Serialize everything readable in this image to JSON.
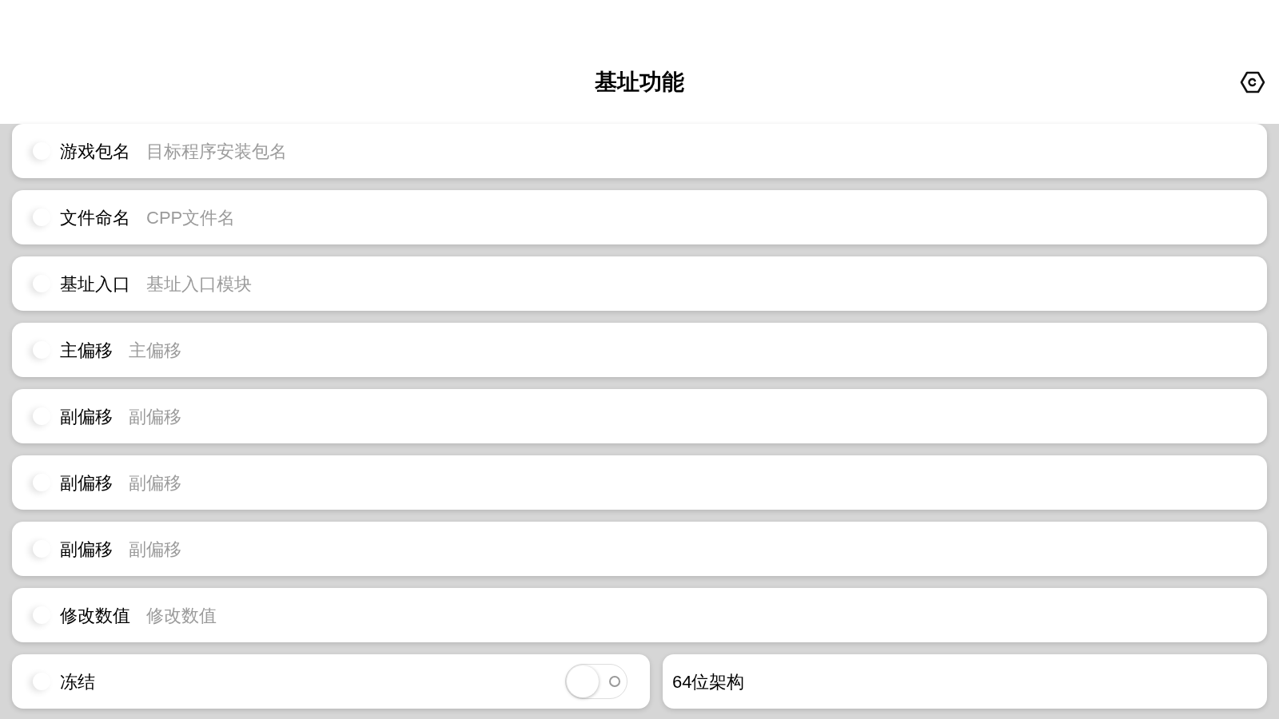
{
  "title": "基址功能",
  "fields": [
    {
      "label": "游戏包名",
      "placeholder": "目标程序安装包名"
    },
    {
      "label": "文件命名",
      "placeholder": "CPP文件名"
    },
    {
      "label": "基址入口",
      "placeholder": "基址入口模块"
    },
    {
      "label": "主偏移",
      "placeholder": "主偏移"
    },
    {
      "label": "副偏移",
      "placeholder": "副偏移"
    },
    {
      "label": "副偏移",
      "placeholder": "副偏移"
    },
    {
      "label": "副偏移",
      "placeholder": "副偏移"
    },
    {
      "label": "修改数值",
      "placeholder": "修改数值"
    }
  ],
  "freeze": {
    "label": "冻结",
    "on": false
  },
  "arch": {
    "label": "64位架构"
  }
}
